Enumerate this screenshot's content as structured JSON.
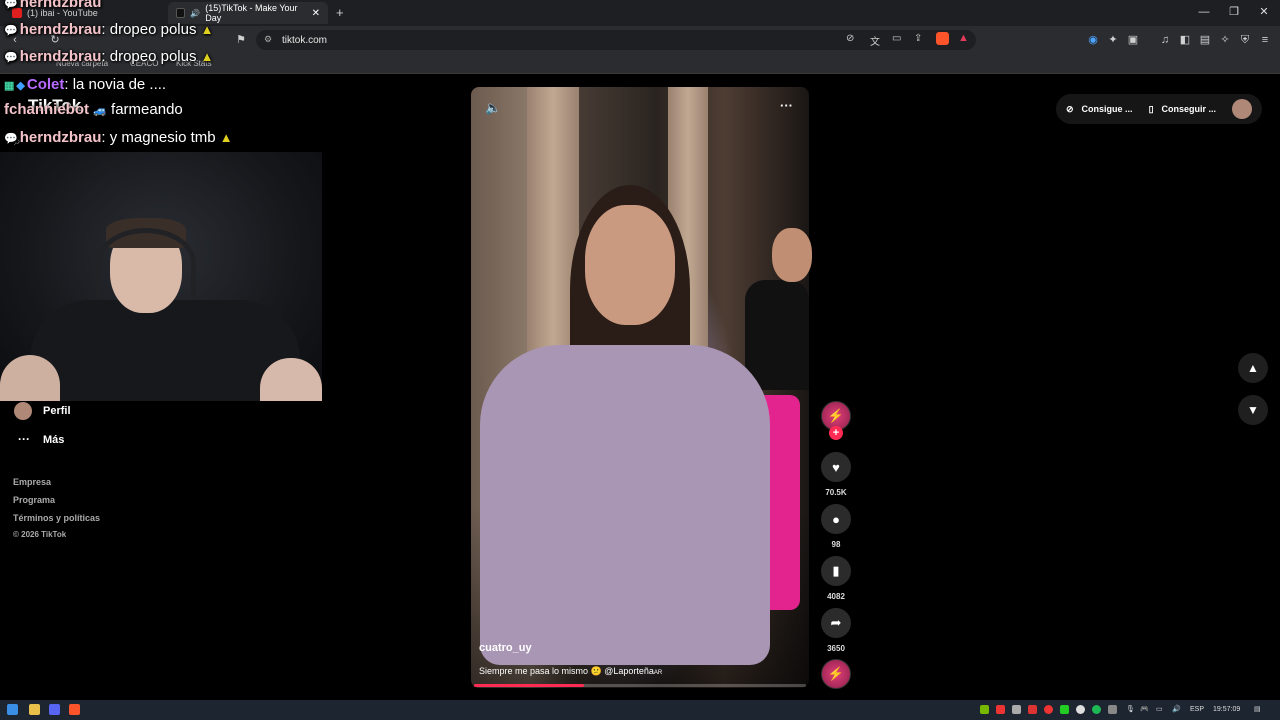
{
  "browser": {
    "tabs": [
      {
        "label": "(1) ibai - YouTube",
        "icon": "youtube-icon"
      },
      {
        "label": "(15)TikTok - Make Your Day",
        "icon": "tiktok-icon",
        "active": true
      }
    ],
    "new_tab": "+",
    "url": "tiktok.com",
    "bookmarks": [
      "Nueva carpeta",
      "CEACO",
      "Kick Stats"
    ]
  },
  "chat": [
    {
      "user": "herndzbrau",
      "text": "",
      "color": "#f3c3c9"
    },
    {
      "user": "herndzbrau",
      "text": ": dropeo polus",
      "color": "#f3c3c9"
    },
    {
      "user": "herndzbrau",
      "text": ": dropeo polus",
      "color": "#f3c3c9"
    },
    {
      "user": "Colet",
      "text": ": la novia de ....",
      "color": "#b86bff"
    },
    {
      "user": "fchanniebot",
      "text": "farmeando",
      "color": "#f3c3c9"
    },
    {
      "user": "herndzbrau",
      "text": ": y magnesio tmb",
      "color": "#f3c3c9"
    }
  ],
  "tiktok_logo": "TikTok",
  "sidebar": {
    "profile": "Perfil",
    "more": "Más",
    "footer": [
      "Empresa",
      "Programa",
      "Términos y políticas",
      "© 2026 TikTok"
    ]
  },
  "video": {
    "author": "cuatro_uy",
    "caption": "Siempre me pasa lo mismo 😕 @Laporteña",
    "caption_tag": "AR",
    "progress": 0.33
  },
  "actions": {
    "likes": "70.5K",
    "comments": "98",
    "saves": "4082",
    "shares": "3650"
  },
  "topright": {
    "coins": "Consigue ...",
    "app": "Conseguir ..."
  },
  "taskbar": {
    "lang": "ESP",
    "time": "19:57:09"
  }
}
